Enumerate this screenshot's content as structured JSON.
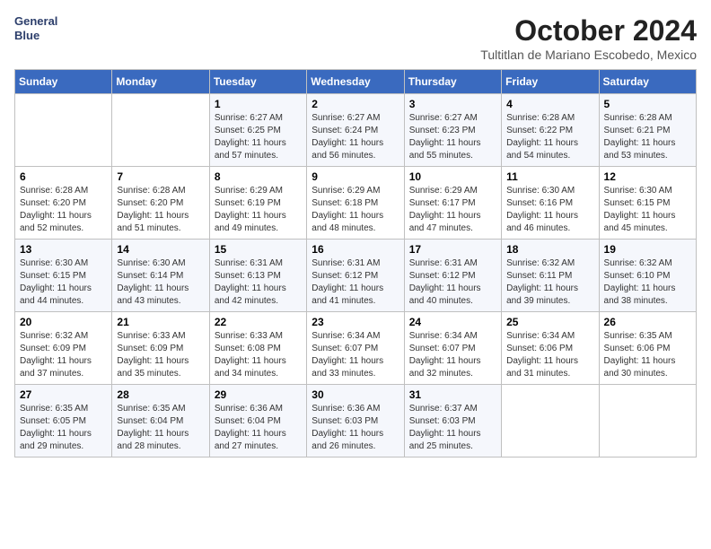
{
  "header": {
    "logo_line1": "General",
    "logo_line2": "Blue",
    "month": "October 2024",
    "location": "Tultitlan de Mariano Escobedo, Mexico"
  },
  "days_of_week": [
    "Sunday",
    "Monday",
    "Tuesday",
    "Wednesday",
    "Thursday",
    "Friday",
    "Saturday"
  ],
  "weeks": [
    [
      {
        "day": "",
        "info": ""
      },
      {
        "day": "",
        "info": ""
      },
      {
        "day": "1",
        "info": "Sunrise: 6:27 AM\nSunset: 6:25 PM\nDaylight: 11 hours and 57 minutes."
      },
      {
        "day": "2",
        "info": "Sunrise: 6:27 AM\nSunset: 6:24 PM\nDaylight: 11 hours and 56 minutes."
      },
      {
        "day": "3",
        "info": "Sunrise: 6:27 AM\nSunset: 6:23 PM\nDaylight: 11 hours and 55 minutes."
      },
      {
        "day": "4",
        "info": "Sunrise: 6:28 AM\nSunset: 6:22 PM\nDaylight: 11 hours and 54 minutes."
      },
      {
        "day": "5",
        "info": "Sunrise: 6:28 AM\nSunset: 6:21 PM\nDaylight: 11 hours and 53 minutes."
      }
    ],
    [
      {
        "day": "6",
        "info": "Sunrise: 6:28 AM\nSunset: 6:20 PM\nDaylight: 11 hours and 52 minutes."
      },
      {
        "day": "7",
        "info": "Sunrise: 6:28 AM\nSunset: 6:20 PM\nDaylight: 11 hours and 51 minutes."
      },
      {
        "day": "8",
        "info": "Sunrise: 6:29 AM\nSunset: 6:19 PM\nDaylight: 11 hours and 49 minutes."
      },
      {
        "day": "9",
        "info": "Sunrise: 6:29 AM\nSunset: 6:18 PM\nDaylight: 11 hours and 48 minutes."
      },
      {
        "day": "10",
        "info": "Sunrise: 6:29 AM\nSunset: 6:17 PM\nDaylight: 11 hours and 47 minutes."
      },
      {
        "day": "11",
        "info": "Sunrise: 6:30 AM\nSunset: 6:16 PM\nDaylight: 11 hours and 46 minutes."
      },
      {
        "day": "12",
        "info": "Sunrise: 6:30 AM\nSunset: 6:15 PM\nDaylight: 11 hours and 45 minutes."
      }
    ],
    [
      {
        "day": "13",
        "info": "Sunrise: 6:30 AM\nSunset: 6:15 PM\nDaylight: 11 hours and 44 minutes."
      },
      {
        "day": "14",
        "info": "Sunrise: 6:30 AM\nSunset: 6:14 PM\nDaylight: 11 hours and 43 minutes."
      },
      {
        "day": "15",
        "info": "Sunrise: 6:31 AM\nSunset: 6:13 PM\nDaylight: 11 hours and 42 minutes."
      },
      {
        "day": "16",
        "info": "Sunrise: 6:31 AM\nSunset: 6:12 PM\nDaylight: 11 hours and 41 minutes."
      },
      {
        "day": "17",
        "info": "Sunrise: 6:31 AM\nSunset: 6:12 PM\nDaylight: 11 hours and 40 minutes."
      },
      {
        "day": "18",
        "info": "Sunrise: 6:32 AM\nSunset: 6:11 PM\nDaylight: 11 hours and 39 minutes."
      },
      {
        "day": "19",
        "info": "Sunrise: 6:32 AM\nSunset: 6:10 PM\nDaylight: 11 hours and 38 minutes."
      }
    ],
    [
      {
        "day": "20",
        "info": "Sunrise: 6:32 AM\nSunset: 6:09 PM\nDaylight: 11 hours and 37 minutes."
      },
      {
        "day": "21",
        "info": "Sunrise: 6:33 AM\nSunset: 6:09 PM\nDaylight: 11 hours and 35 minutes."
      },
      {
        "day": "22",
        "info": "Sunrise: 6:33 AM\nSunset: 6:08 PM\nDaylight: 11 hours and 34 minutes."
      },
      {
        "day": "23",
        "info": "Sunrise: 6:34 AM\nSunset: 6:07 PM\nDaylight: 11 hours and 33 minutes."
      },
      {
        "day": "24",
        "info": "Sunrise: 6:34 AM\nSunset: 6:07 PM\nDaylight: 11 hours and 32 minutes."
      },
      {
        "day": "25",
        "info": "Sunrise: 6:34 AM\nSunset: 6:06 PM\nDaylight: 11 hours and 31 minutes."
      },
      {
        "day": "26",
        "info": "Sunrise: 6:35 AM\nSunset: 6:06 PM\nDaylight: 11 hours and 30 minutes."
      }
    ],
    [
      {
        "day": "27",
        "info": "Sunrise: 6:35 AM\nSunset: 6:05 PM\nDaylight: 11 hours and 29 minutes."
      },
      {
        "day": "28",
        "info": "Sunrise: 6:35 AM\nSunset: 6:04 PM\nDaylight: 11 hours and 28 minutes."
      },
      {
        "day": "29",
        "info": "Sunrise: 6:36 AM\nSunset: 6:04 PM\nDaylight: 11 hours and 27 minutes."
      },
      {
        "day": "30",
        "info": "Sunrise: 6:36 AM\nSunset: 6:03 PM\nDaylight: 11 hours and 26 minutes."
      },
      {
        "day": "31",
        "info": "Sunrise: 6:37 AM\nSunset: 6:03 PM\nDaylight: 11 hours and 25 minutes."
      },
      {
        "day": "",
        "info": ""
      },
      {
        "day": "",
        "info": ""
      }
    ]
  ]
}
